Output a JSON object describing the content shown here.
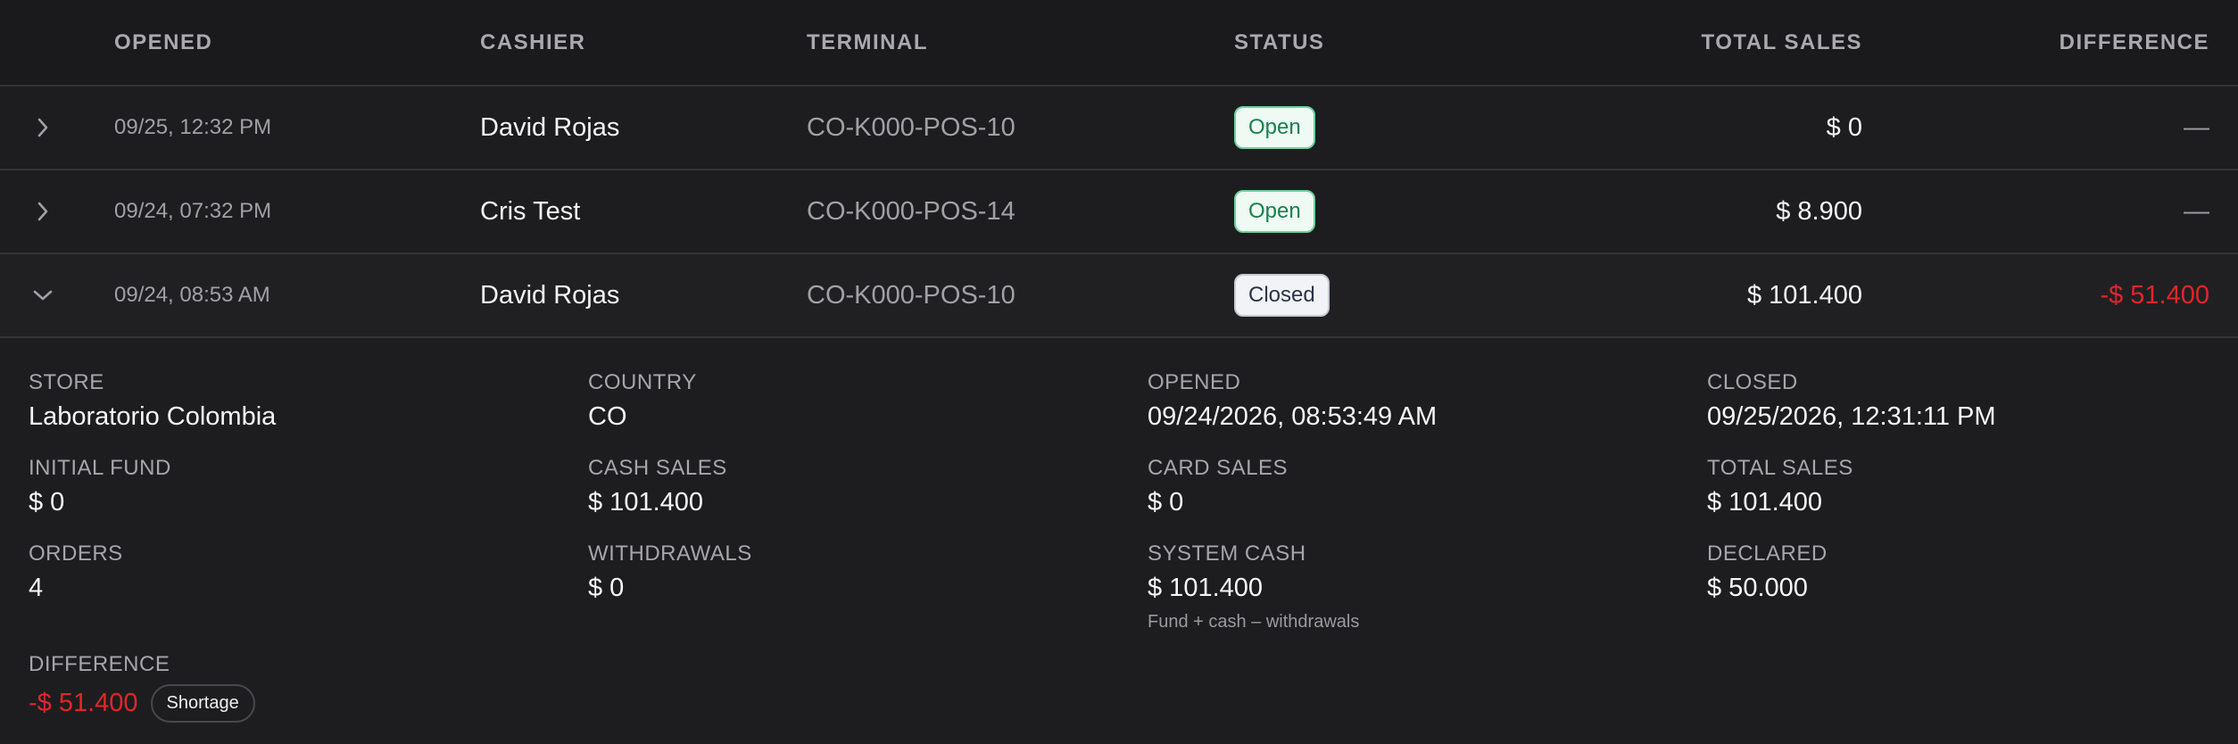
{
  "table": {
    "headers": {
      "opened": "OPENED",
      "cashier": "CASHIER",
      "terminal": "TERMINAL",
      "status": "STATUS",
      "total_sales": "TOTAL SALES",
      "difference": "DIFFERENCE"
    },
    "rows": [
      {
        "opened": "09/25, 12:32 PM",
        "cashier": "David Rojas",
        "terminal": "CO-K000-POS-10",
        "status": "Open",
        "total_sales": "$ 0",
        "difference": "—"
      },
      {
        "opened": "09/24, 07:32 PM",
        "cashier": "Cris Test",
        "terminal": "CO-K000-POS-14",
        "status": "Open",
        "total_sales": "$ 8.900",
        "difference": "—"
      },
      {
        "opened": "09/24, 08:53 AM",
        "cashier": "David Rojas",
        "terminal": "CO-K000-POS-10",
        "status": "Closed",
        "total_sales": "$ 101.400",
        "difference": "-$ 51.400"
      }
    ]
  },
  "details": {
    "store": {
      "label": "STORE",
      "value": "Laboratorio Colombia"
    },
    "country": {
      "label": "COUNTRY",
      "value": "CO"
    },
    "opened": {
      "label": "OPENED",
      "value": "09/24/2026, 08:53:49 AM"
    },
    "closed": {
      "label": "CLOSED",
      "value": "09/25/2026, 12:31:11 PM"
    },
    "initial_fund": {
      "label": "INITIAL FUND",
      "value": "$ 0"
    },
    "cash_sales": {
      "label": "CASH SALES",
      "value": "$ 101.400"
    },
    "card_sales": {
      "label": "CARD SALES",
      "value": "$ 0"
    },
    "total_sales": {
      "label": "TOTAL SALES",
      "value": "$ 101.400"
    },
    "orders": {
      "label": "ORDERS",
      "value": "4"
    },
    "withdrawals": {
      "label": "WITHDRAWALS",
      "value": "$ 0"
    },
    "system_cash": {
      "label": "SYSTEM CASH",
      "value": "$ 101.400",
      "note": "Fund + cash – withdrawals"
    },
    "declared": {
      "label": "DECLARED",
      "value": "$ 50.000"
    },
    "difference": {
      "label": "DIFFERENCE",
      "value": "-$ 51.400",
      "badge": "Shortage"
    }
  },
  "icons": {
    "collapsed": "chevron-right-icon",
    "expanded": "chevron-down-icon"
  },
  "colors": {
    "background": "#1d1d1f",
    "negative": "#e0262b",
    "open_badge_bg": "#eefaf3",
    "open_badge_text": "#17804a",
    "closed_badge_bg": "#f2f3f6",
    "closed_badge_text": "#2a3448"
  }
}
